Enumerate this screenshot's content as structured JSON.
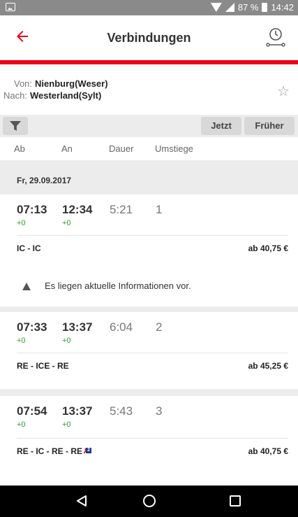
{
  "status_bar": {
    "battery_text": "87 %",
    "time": "14:42"
  },
  "app_bar": {
    "title": "Verbindungen",
    "back_icon": "arrow-back-icon",
    "action_icon": "clock-route-icon"
  },
  "route": {
    "von_label": "Von:",
    "von_value": "Nienburg(Weser)",
    "nach_label": "Nach:",
    "nach_value": "Westerland(Sylt)",
    "favorite_icon": "star-outline-icon"
  },
  "toolbar": {
    "filter_icon": "filter-icon",
    "jetzt_label": "Jetzt",
    "frueher_label": "Früher"
  },
  "columns": {
    "ab": "Ab",
    "an": "An",
    "dauer": "Dauer",
    "umstiege": "Umstiege"
  },
  "date_header": "Fr, 29.09.2017",
  "connections": [
    {
      "ab": "07:13",
      "an": "12:34",
      "dauer": "5:21",
      "umstiege": "1",
      "ab_delay": "+0",
      "an_delay": "+0",
      "trains": "IC - IC",
      "price": "ab 40,75 €",
      "info": "Es liegen aktuelle Informationen vor."
    },
    {
      "ab": "07:33",
      "an": "13:37",
      "dauer": "6:04",
      "umstiege": "2",
      "ab_delay": "+0",
      "an_delay": "+0",
      "trains": "RE - ICE - RE",
      "price": "ab 45,25 €"
    },
    {
      "ab": "07:54",
      "an": "13:37",
      "dauer": "5:43",
      "umstiege": "3",
      "ab_delay": "+0",
      "an_delay": "+0",
      "trains": "RE - IC - RE - RE",
      "class_badge": "2",
      "price": "ab 40,75 €"
    }
  ],
  "colors": {
    "accent": "#ec0016",
    "delay_ok": "#2a9d2a"
  },
  "nav_bar": {
    "back": "nav-back-icon",
    "home": "nav-home-icon",
    "recents": "nav-recents-icon"
  }
}
